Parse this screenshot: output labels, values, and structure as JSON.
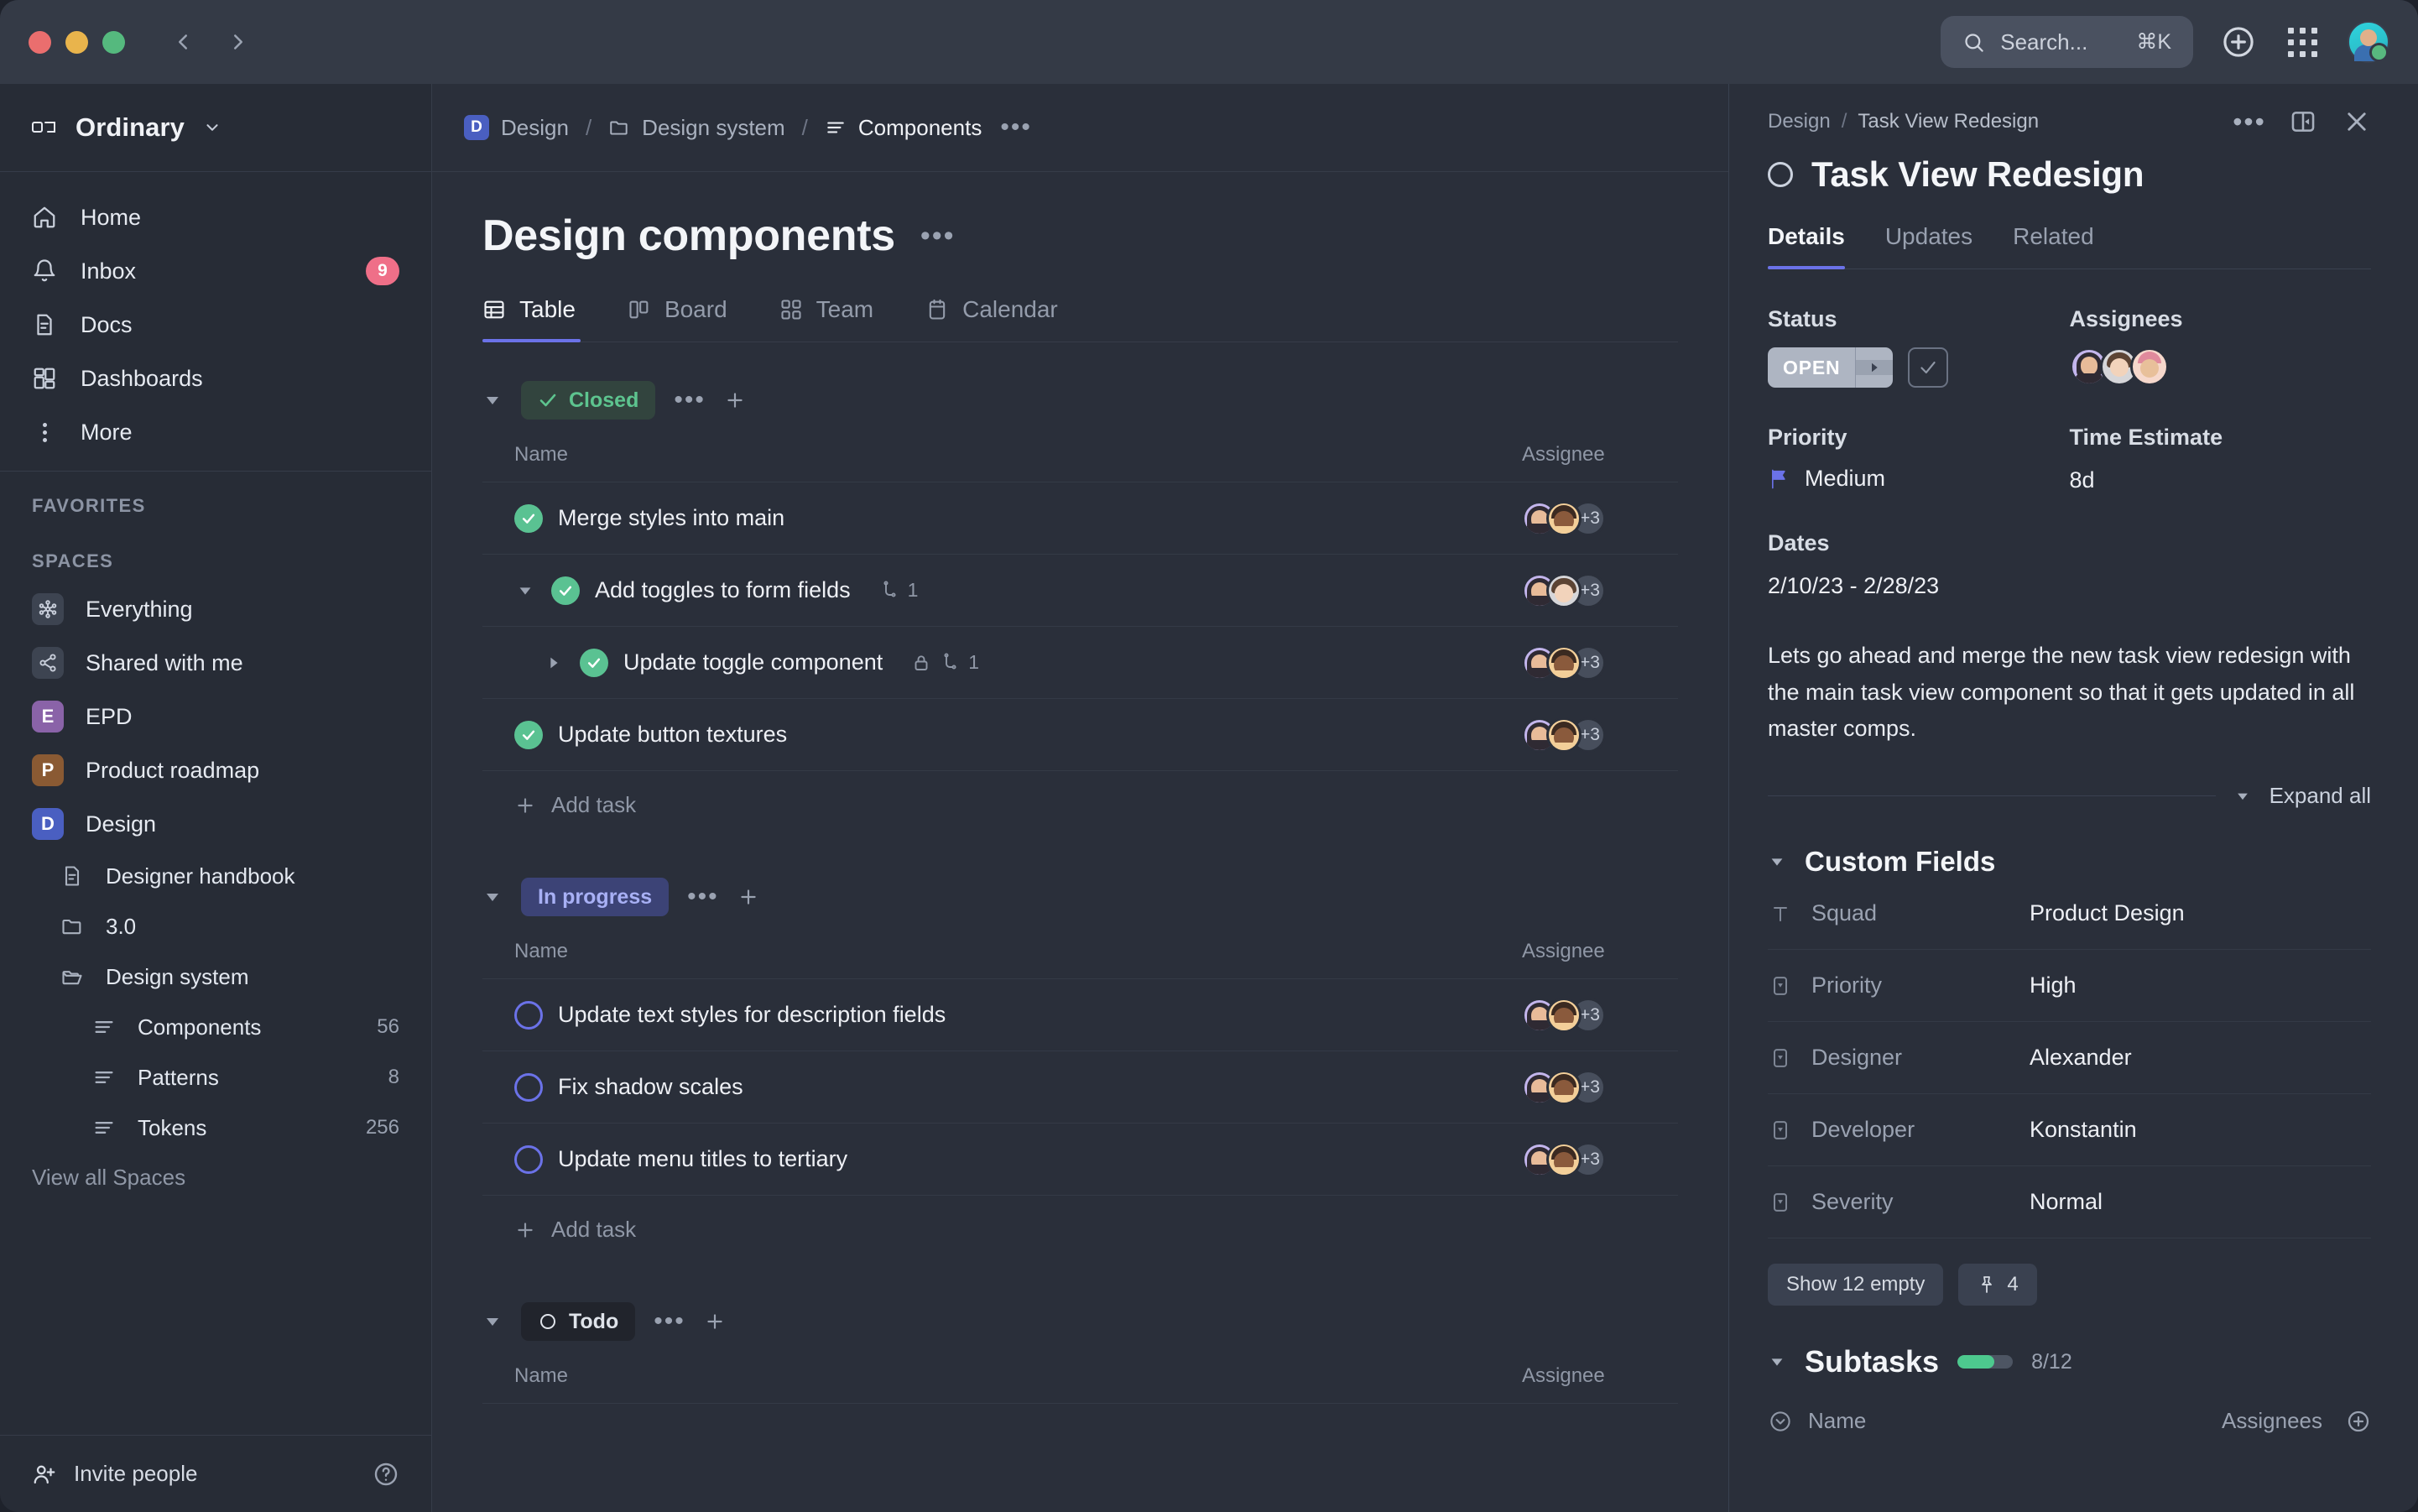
{
  "titlebar": {
    "nav_back": "back-arrow",
    "nav_forward": "forward-arrow",
    "search_placeholder": "Search...",
    "search_shortcut": "⌘K",
    "add_label": "+",
    "apps_label": "apps"
  },
  "sidebar": {
    "workspace": "Ordinary",
    "nav": [
      {
        "label": "Home",
        "icon": "home-icon",
        "badge": ""
      },
      {
        "label": "Inbox",
        "icon": "bell-icon",
        "badge": "9"
      },
      {
        "label": "Docs",
        "icon": "doc-icon",
        "badge": ""
      },
      {
        "label": "Dashboards",
        "icon": "dashboard-icon",
        "badge": ""
      },
      {
        "label": "More",
        "icon": "more-vertical-icon",
        "badge": ""
      }
    ],
    "favorites_label": "FAVORITES",
    "spaces_label": "SPACES",
    "spaces": [
      {
        "label": "Everything",
        "avatar": "",
        "kind": "grey",
        "icon": "hub-icon"
      },
      {
        "label": "Shared with me",
        "avatar": "",
        "kind": "grey",
        "icon": "share-icon"
      },
      {
        "label": "EPD",
        "avatar": "E",
        "kind": "purple",
        "icon": ""
      },
      {
        "label": "Product roadmap",
        "avatar": "P",
        "kind": "brown",
        "icon": ""
      },
      {
        "label": "Design",
        "avatar": "D",
        "kind": "blue",
        "icon": ""
      }
    ],
    "design_children": [
      {
        "label": "Designer handbook",
        "icon": "doc-icon",
        "count": "",
        "deep": false
      },
      {
        "label": "3.0",
        "icon": "folder-icon",
        "count": "",
        "deep": false
      },
      {
        "label": "Design system",
        "icon": "folder-open-icon",
        "count": "",
        "deep": false
      },
      {
        "label": "Components",
        "icon": "list-icon",
        "count": "56",
        "deep": true
      },
      {
        "label": "Patterns",
        "icon": "list-icon",
        "count": "8",
        "deep": true
      },
      {
        "label": "Tokens",
        "icon": "list-icon",
        "count": "256",
        "deep": true
      }
    ],
    "view_all": "View all Spaces",
    "invite": "Invite people",
    "help_icon": "help-circle-icon"
  },
  "breadcrumb": {
    "space_badge": "D",
    "space": "Design",
    "folder": "Design system",
    "list": "Components",
    "sep": "/",
    "dots": "•••"
  },
  "page": {
    "title": "Design components",
    "dots": "•••",
    "tabs": [
      {
        "label": "Table",
        "icon": "table-icon",
        "active": true
      },
      {
        "label": "Board",
        "icon": "board-icon",
        "active": false
      },
      {
        "label": "Team",
        "icon": "team-icon",
        "active": false
      },
      {
        "label": "Calendar",
        "icon": "calendar-icon",
        "active": false
      }
    ],
    "col_name": "Name",
    "col_assignee": "Assignee",
    "add_task": "Add task",
    "avatar_more": "+3"
  },
  "groups": [
    {
      "label": "Closed",
      "style": "closed",
      "icon": "check-icon",
      "rows": [
        {
          "name": "Merge styles into main",
          "state": "done",
          "indent": 1,
          "caret": "none",
          "lock": false,
          "sub_count": ""
        },
        {
          "name": "Add toggles to form fields",
          "state": "done",
          "indent": 1,
          "caret": "down",
          "lock": false,
          "sub_count": "1"
        },
        {
          "name": "Update toggle component",
          "state": "done",
          "indent": 2,
          "caret": "right",
          "lock": true,
          "sub_count": "1"
        },
        {
          "name": "Update button textures",
          "state": "done",
          "indent": 1,
          "caret": "none",
          "lock": false,
          "sub_count": ""
        }
      ]
    },
    {
      "label": "In progress",
      "style": "inprog",
      "icon": "",
      "rows": [
        {
          "name": "Update text styles for description fields",
          "state": "open",
          "indent": 1,
          "caret": "none",
          "lock": false,
          "sub_count": ""
        },
        {
          "name": "Fix shadow scales",
          "state": "open",
          "indent": 1,
          "caret": "none",
          "lock": false,
          "sub_count": ""
        },
        {
          "name": "Update menu titles to tertiary",
          "state": "open",
          "indent": 1,
          "caret": "none",
          "lock": false,
          "sub_count": ""
        }
      ]
    },
    {
      "label": "Todo",
      "style": "todo",
      "icon": "circle-icon",
      "rows": []
    }
  ],
  "panel": {
    "crumb_space": "Design",
    "crumb_task": "Task View Redesign",
    "crumb_sep": "/",
    "dots": "•••",
    "title": "Task View Redesign",
    "tabs": [
      {
        "label": "Details",
        "active": true
      },
      {
        "label": "Updates",
        "active": false
      },
      {
        "label": "Related",
        "active": false
      }
    ],
    "status_label": "Status",
    "status_value": "OPEN",
    "assignees_label": "Assignees",
    "priority_label": "Priority",
    "priority_value": "Medium",
    "time_label": "Time Estimate",
    "time_value": "8d",
    "dates_label": "Dates",
    "dates_value": "2/10/23 - 2/28/23",
    "description": "Lets go ahead and merge the new task view redesign with the main task view component so that it gets updated in all master comps.",
    "expand_all": "Expand all",
    "custom_fields_title": "Custom Fields",
    "custom_fields": [
      {
        "icon": "text-field-icon",
        "label": "Squad",
        "value": "Product Design"
      },
      {
        "icon": "dropdown-field-icon",
        "label": "Priority",
        "value": "High"
      },
      {
        "icon": "dropdown-field-icon",
        "label": "Designer",
        "value": "Alexander"
      },
      {
        "icon": "dropdown-field-icon",
        "label": "Developer",
        "value": "Konstantin"
      },
      {
        "icon": "dropdown-field-icon",
        "label": "Severity",
        "value": "Normal"
      }
    ],
    "show_empty": "Show 12 empty",
    "pinned_count": "4",
    "subtasks_title": "Subtasks",
    "subtasks_fraction": "8/12",
    "subtasks_percent": 66,
    "subtasks_col_name": "Name",
    "subtasks_col_assignees": "Assignees"
  },
  "colors": {
    "accent": "#6b72e8",
    "done_green": "#5ac292",
    "badge_red": "#ef6f88",
    "closed_pill_bg": "#32443e",
    "closed_pill_fg": "#5dc48f",
    "inprogress_pill_bg": "#3c4376",
    "inprogress_pill_fg": "#a8b0f5"
  }
}
